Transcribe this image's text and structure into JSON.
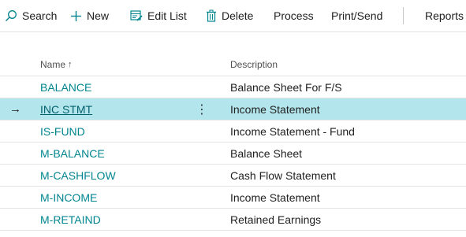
{
  "toolbar": {
    "search": "Search",
    "new": "New",
    "edit_list": "Edit List",
    "delete": "Delete",
    "process": "Process",
    "print_send": "Print/Send",
    "reports": "Reports",
    "accent": "#00858f"
  },
  "table": {
    "columns": {
      "name": "Name",
      "description": "Description",
      "sort_indicator": "↑"
    },
    "rows": [
      {
        "name": "BALANCE",
        "description": "Balance Sheet For F/S"
      },
      {
        "name": "INC STMT",
        "description": "Income Statement",
        "selected": true
      },
      {
        "name": "IS-FUND",
        "description": "Income Statement - Fund"
      },
      {
        "name": "M-BALANCE",
        "description": "Balance Sheet"
      },
      {
        "name": "M-CASHFLOW",
        "description": "Cash Flow Statement"
      },
      {
        "name": "M-INCOME",
        "description": "Income Statement"
      },
      {
        "name": "M-RETAIND",
        "description": "Retained Earnings"
      }
    ],
    "selected_row_marker": "→",
    "row_menu_glyph": "⋮"
  }
}
